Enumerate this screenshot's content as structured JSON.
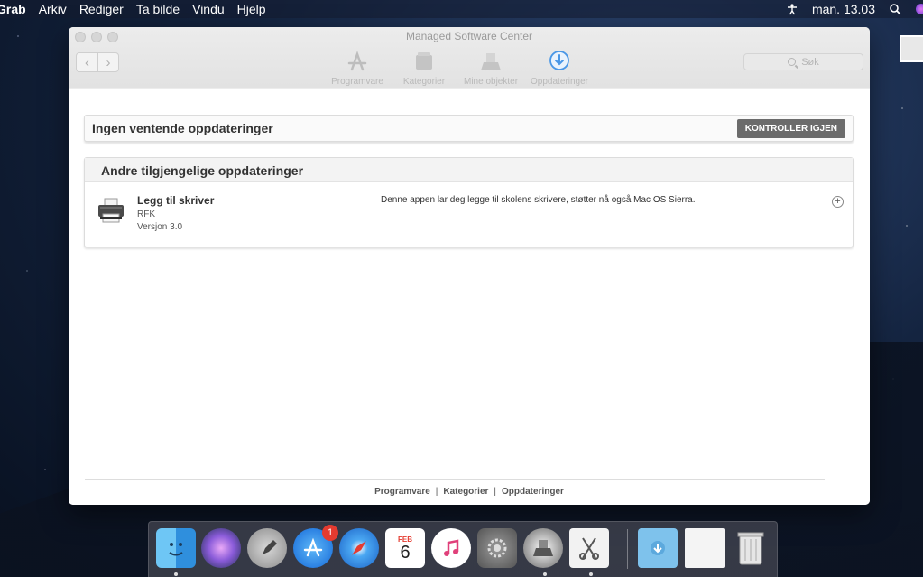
{
  "menubar": {
    "app": "Grab",
    "items": [
      "Arkiv",
      "Rediger",
      "Ta bilde",
      "Vindu",
      "Hjelp"
    ],
    "clock": "man. 13.03"
  },
  "window": {
    "title": "Managed Software Center",
    "toolbar": [
      {
        "label": "Programvare",
        "icon": "app-store-icon"
      },
      {
        "label": "Kategorier",
        "icon": "categories-icon"
      },
      {
        "label": "Mine objekter",
        "icon": "my-items-icon"
      },
      {
        "label": "Oppdateringer",
        "icon": "updates-icon"
      }
    ],
    "search_placeholder": "Søk"
  },
  "pending": {
    "title": "Ingen ventende oppdateringer",
    "button": "KONTROLLER IGJEN"
  },
  "other": {
    "title": "Andre tilgjengelige oppdateringer",
    "items": [
      {
        "name": "Legg til skriver",
        "developer": "RFK",
        "version": "Versjon 3.0",
        "description": "Denne appen lar deg legge til skolens skrivere, støtter nå også Mac OS Sierra.",
        "icon": "printer-icon"
      }
    ]
  },
  "footer": [
    "Programvare",
    "Kategorier",
    "Oppdateringer"
  ],
  "dock": {
    "app_store_badge": "1",
    "calendar_month": "FEB",
    "calendar_day": "6"
  },
  "colors": {
    "button_bg": "#6b6b6b",
    "badge": "#e53b30"
  }
}
